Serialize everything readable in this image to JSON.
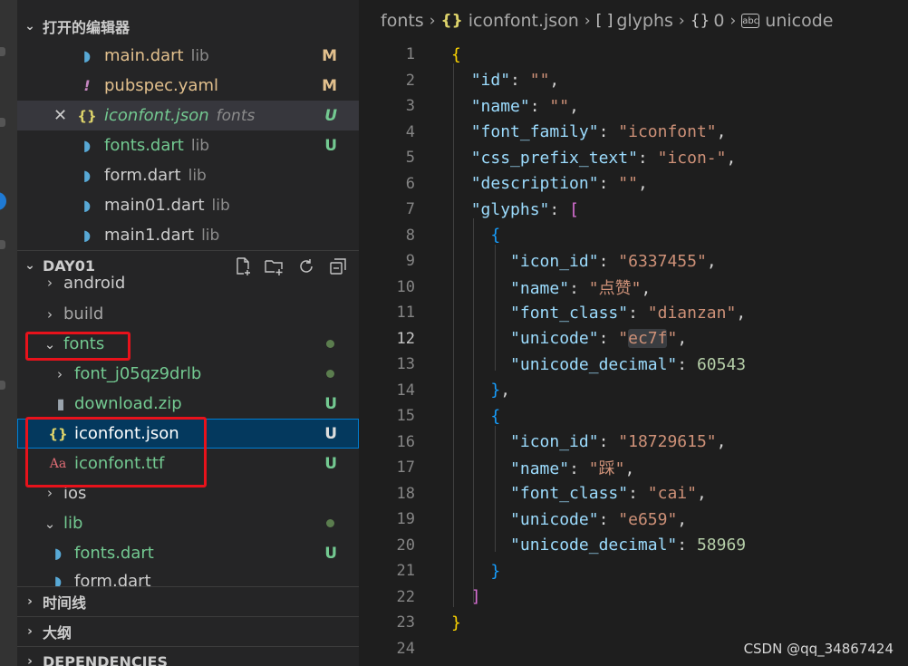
{
  "open_editors": {
    "title": "打开的编辑器",
    "items": [
      {
        "name": "main.dart",
        "desc": "lib",
        "badge": "M"
      },
      {
        "name": "pubspec.yaml",
        "desc": "",
        "badge": "M"
      },
      {
        "name": "iconfont.json",
        "desc": "fonts",
        "badge": "U"
      },
      {
        "name": "fonts.dart",
        "desc": "lib",
        "badge": "U"
      },
      {
        "name": "form.dart",
        "desc": "lib",
        "badge": ""
      },
      {
        "name": "main01.dart",
        "desc": "lib",
        "badge": ""
      },
      {
        "name": "main1.dart",
        "desc": "lib",
        "badge": ""
      }
    ]
  },
  "explorer": {
    "title": "DAY01",
    "tree": [
      {
        "name": "android",
        "badge": ""
      },
      {
        "name": "build",
        "badge": ""
      },
      {
        "name": "fonts",
        "badge": ""
      },
      {
        "name": "font_j05qz9drlb",
        "badge": ""
      },
      {
        "name": "download.zip",
        "badge": "U"
      },
      {
        "name": "iconfont.json",
        "badge": "U"
      },
      {
        "name": "iconfont.ttf",
        "badge": "U"
      },
      {
        "name": "ios",
        "badge": ""
      },
      {
        "name": "lib",
        "badge": ""
      },
      {
        "name": "fonts.dart",
        "badge": "U"
      },
      {
        "name": "form.dart",
        "badge": ""
      }
    ]
  },
  "sections": {
    "timeline": "时间线",
    "outline": "大纲",
    "dependencies": "DEPENDENCIES"
  },
  "breadcrumb": {
    "folder": "fonts",
    "file": "iconfont.json",
    "array": "glyphs",
    "index": "0",
    "key": "unicode",
    "sep": "›",
    "obj_glyph": "{}",
    "arr_glyph": "[ ]",
    "abc_glyph": "abc"
  },
  "code": {
    "current_line": 12,
    "lines": [
      {
        "n": "1",
        "t": "{"
      },
      {
        "n": "2",
        "t": "  \"id\": \"\","
      },
      {
        "n": "3",
        "t": "  \"name\": \"\","
      },
      {
        "n": "4",
        "t": "  \"font_family\": \"iconfont\","
      },
      {
        "n": "5",
        "t": "  \"css_prefix_text\": \"icon-\","
      },
      {
        "n": "6",
        "t": "  \"description\": \"\","
      },
      {
        "n": "7",
        "t": "  \"glyphs\": ["
      },
      {
        "n": "8",
        "t": "    {"
      },
      {
        "n": "9",
        "t": "      \"icon_id\": \"6337455\","
      },
      {
        "n": "10",
        "t": "      \"name\": \"点赞\","
      },
      {
        "n": "11",
        "t": "      \"font_class\": \"dianzan\","
      },
      {
        "n": "12",
        "t": "      \"unicode\": \"ec7f\","
      },
      {
        "n": "13",
        "t": "      \"unicode_decimal\": 60543"
      },
      {
        "n": "14",
        "t": "    },"
      },
      {
        "n": "15",
        "t": "    {"
      },
      {
        "n": "16",
        "t": "      \"icon_id\": \"18729615\","
      },
      {
        "n": "17",
        "t": "      \"name\": \"踩\","
      },
      {
        "n": "18",
        "t": "      \"font_class\": \"cai\","
      },
      {
        "n": "19",
        "t": "      \"unicode\": \"e659\","
      },
      {
        "n": "20",
        "t": "      \"unicode_decimal\": 58969"
      },
      {
        "n": "21",
        "t": "    }"
      },
      {
        "n": "22",
        "t": "  ]"
      },
      {
        "n": "23",
        "t": "}"
      },
      {
        "n": "24",
        "t": ""
      }
    ]
  },
  "watermark": "CSDN @qq_34867424",
  "icons": {
    "dart": "dart-file-icon",
    "yaml": "yaml-file-icon",
    "json": "json-file-icon",
    "ttf": "font-file-icon",
    "zip": "zip-file-icon"
  },
  "colors": {
    "selection": "#04395e",
    "untracked": "#73c991",
    "modified": "#e2c08d",
    "annotation": "#e8121b"
  }
}
